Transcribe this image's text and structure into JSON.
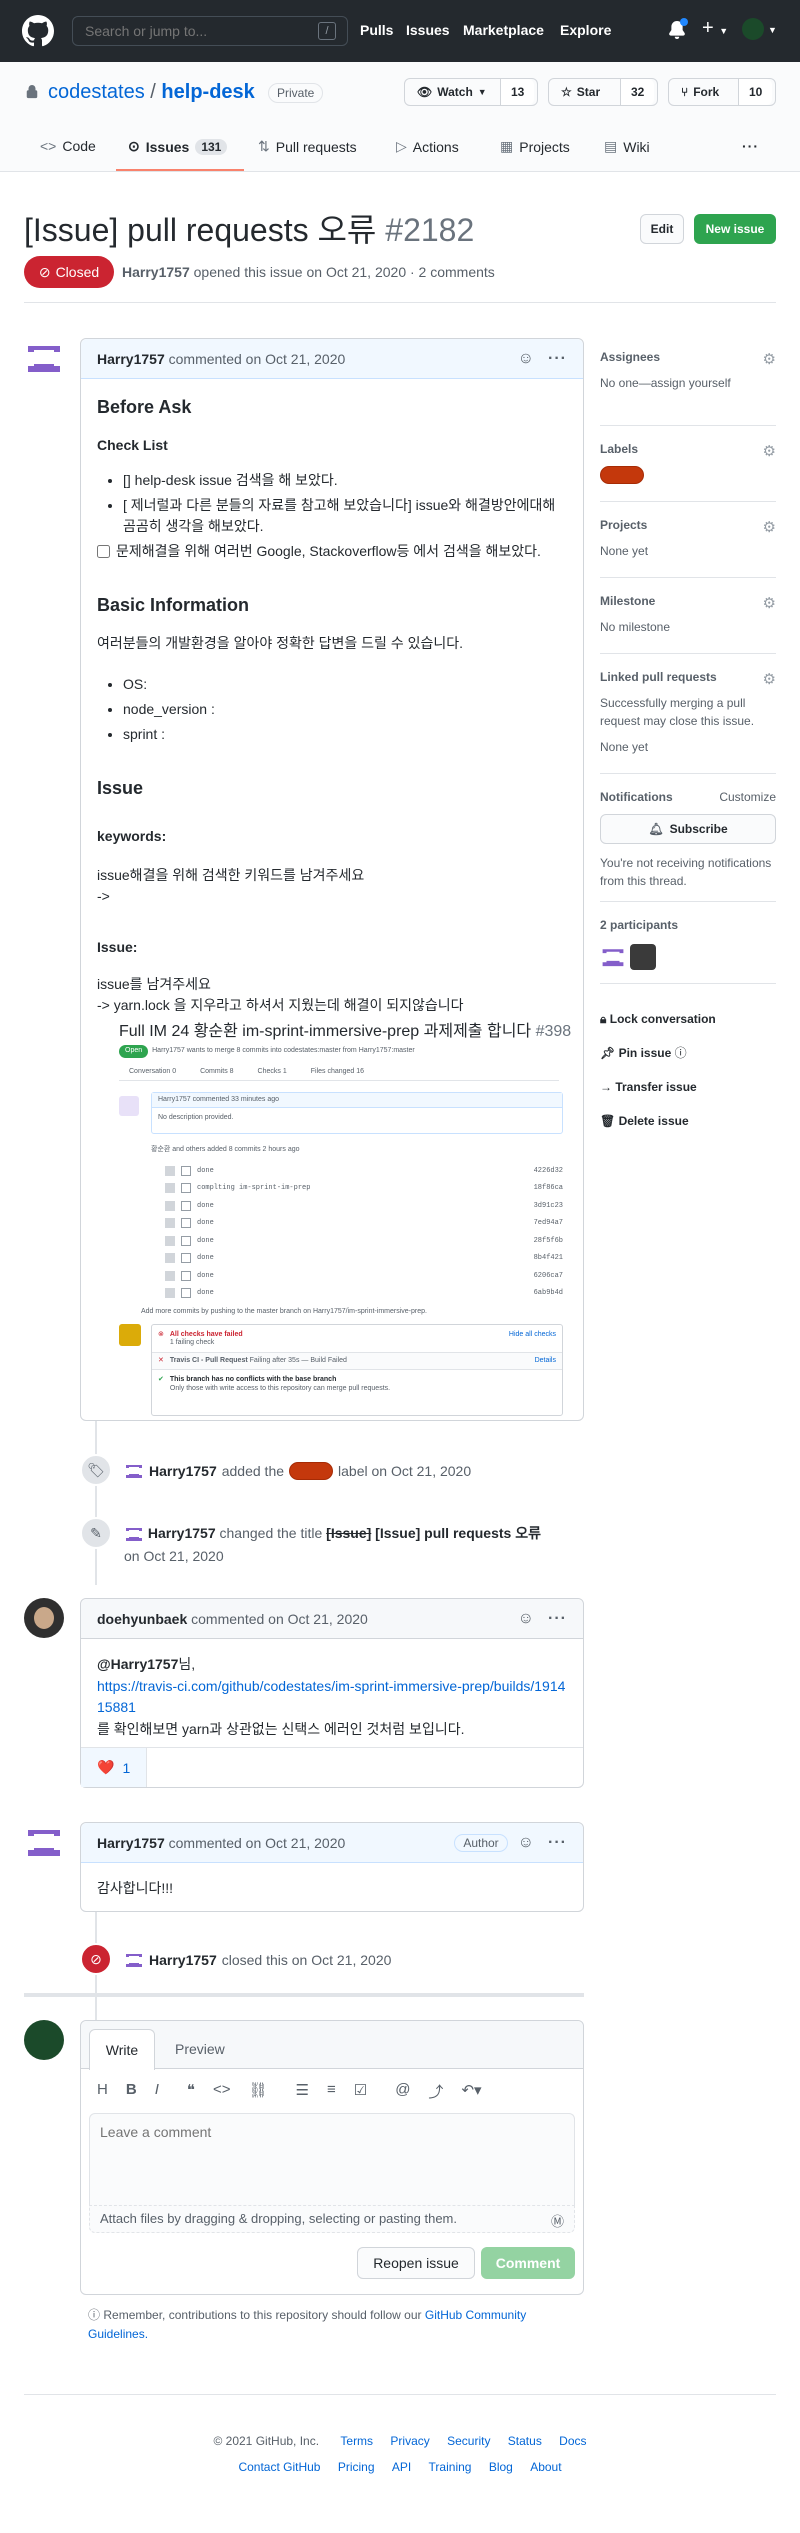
{
  "header": {
    "search_placeholder": "Search or jump to...",
    "search_shortcut": "/",
    "nav": [
      "Pulls",
      "Issues",
      "Marketplace",
      "Explore"
    ]
  },
  "repo": {
    "owner": "codestates",
    "separator": "/",
    "name": "help-desk",
    "visibility": "Private",
    "watch_label": "Watch",
    "watch_count": "13",
    "star_label": "Star",
    "star_count": "32",
    "fork_label": "Fork",
    "fork_count": "10",
    "tabs": [
      {
        "label": "Code"
      },
      {
        "label": "Issues",
        "count": "131"
      },
      {
        "label": "Pull requests"
      },
      {
        "label": "Actions"
      },
      {
        "label": "Projects"
      },
      {
        "label": "Wiki"
      }
    ]
  },
  "issue": {
    "title": "[Issue] pull requests 오류",
    "number": "#2182",
    "edit_label": "Edit",
    "new_label": "New issue",
    "state": "Closed",
    "author": "Harry1757",
    "meta_text": "opened this issue on Oct 21, 2020 · 2 comments"
  },
  "comment1": {
    "author": "Harry1757",
    "action": "commented on Oct 21, 2020",
    "h_before": "Before Ask",
    "h_checklist": "Check List",
    "check_items": [
      "[] help-desk issue 검색을 해 보았다.",
      "[ 제너럴과 다른 분들의 자료를 참고해 보았습니다] issue와 해결방안에대해 곰곰히 생각을 해보았다."
    ],
    "task_item": "문제해결을 위해 여러번 Google, Stackoverflow등 에서 검색을 해보았다.",
    "h_basic": "Basic Information",
    "basic_text": "여러분들의 개발환경을 알아야 정확한 답변을 드릴 수 있습니다.",
    "basic_items": [
      "OS:",
      "node_version :",
      "sprint :"
    ],
    "h_issue": "Issue",
    "h_keywords": "keywords:",
    "keywords_text": "issue해결을 위해 검색한 키워드를 남겨주세요",
    "keywords_arrow": "->",
    "h_issue2": "Issue:",
    "issue_text": "issue를 남겨주세요",
    "issue_text2": "-> yarn.lock 을 지우라고 하셔서 지웠는데 해결이 되지않습니다",
    "embed": {
      "title": "Full IM 24 황순환 im-sprint-immersive-prep 과제제출 합니다",
      "number": "#398",
      "state": "Open",
      "desc": "Harry1757 wants to merge 8 commits into codestates:master from Harry1757:master",
      "tabs": [
        "Conversation 0",
        "Commits 8",
        "Checks 1",
        "Files changed 16"
      ],
      "comment_head": "Harry1757 commented 33 minutes ago",
      "comment_body": "No description provided.",
      "commits_head": "황순환 and others added 8 commits 2 hours ago",
      "commits": [
        {
          "msg": "done",
          "sha": "4226d32"
        },
        {
          "msg": "complting im-sprint-im-prep",
          "sha": "18f86ca"
        },
        {
          "msg": "done",
          "sha": "3d91c23"
        },
        {
          "msg": "done",
          "sha": "7ed94a7"
        },
        {
          "msg": "done",
          "sha": "28f5f6b"
        },
        {
          "msg": "done",
          "sha": "8b4f421"
        },
        {
          "msg": "done",
          "sha": "6206ca7"
        },
        {
          "msg": "done",
          "sha": "6ab9b4d"
        }
      ],
      "add_more": "Add more commits by pushing to the master branch on Harry1757/im-sprint-immersive-prep.",
      "checks_failed": "All checks have failed",
      "checks_sub": "1 failing check",
      "hide_checks": "Hide all checks",
      "travis": "Travis CI - Pull Request",
      "travis_status": "Failing after 35s — Build Failed",
      "details": "Details",
      "no_conflict": "This branch has no conflicts with the base branch",
      "no_conflict_sub": "Only those with write access to this repository can merge pull requests."
    }
  },
  "event_label": {
    "author": "Harry1757",
    "pre": "added the",
    "post": "label on Oct 21, 2020"
  },
  "event_title": {
    "author": "Harry1757",
    "pre": "changed the title",
    "old": "[Issue]",
    "new": "[Issue] pull requests 오류",
    "date": "on Oct 21, 2020"
  },
  "comment2": {
    "author": "doehyunbaek",
    "action": "commented on Oct 21, 2020",
    "mention": "@Harry1757",
    "mention_suffix": "님,",
    "link": "https://travis-ci.com/github/codestates/im-sprint-immersive-prep/builds/191415881",
    "text": "를 확인해보면 yarn과 상관없는 신택스 에러인 것처럼 보입니다.",
    "reaction": "❤️",
    "reaction_count": "1"
  },
  "comment3": {
    "author": "Harry1757",
    "action": "commented on Oct 21, 2020",
    "badge": "Author",
    "text": "감사합니다!!!"
  },
  "event_closed": {
    "author": "Harry1757",
    "text": "closed this on Oct 21, 2020"
  },
  "editor": {
    "tab_write": "Write",
    "tab_preview": "Preview",
    "placeholder": "Leave a comment",
    "attach": "Attach files by dragging & dropping, selecting or pasting them.",
    "reopen": "Reopen issue",
    "comment": "Comment",
    "notice_pre": "Remember, contributions to this repository should follow our",
    "notice_link": "GitHub Community Guidelines."
  },
  "sidebar": {
    "assignees": "Assignees",
    "assignees_val": "No one—assign yourself",
    "labels": "Labels",
    "projects": "Projects",
    "projects_val": "None yet",
    "milestone": "Milestone",
    "milestone_val": "No milestone",
    "linked": "Linked pull requests",
    "linked_val": "Successfully merging a pull request may close this issue.",
    "linked_val2": "None yet",
    "notifications": "Notifications",
    "customize": "Customize",
    "subscribe": "Subscribe",
    "notif_text": "You're not receiving notifications from this thread.",
    "participants": "2 participants",
    "lock": "Lock conversation",
    "pin": "Pin issue",
    "transfer": "Transfer issue",
    "delete": "Delete issue"
  },
  "footer": {
    "copyright": "© 2021 GitHub, Inc.",
    "row1": [
      "Terms",
      "Privacy",
      "Security",
      "Status",
      "Docs"
    ],
    "row2": [
      "Contact GitHub",
      "Pricing",
      "API",
      "Training",
      "Blog",
      "About"
    ]
  },
  "colors": {
    "closed": "#cb2431",
    "new_issue": "#2ea44f",
    "label": "#c4380c",
    "link": "#0366d6"
  }
}
